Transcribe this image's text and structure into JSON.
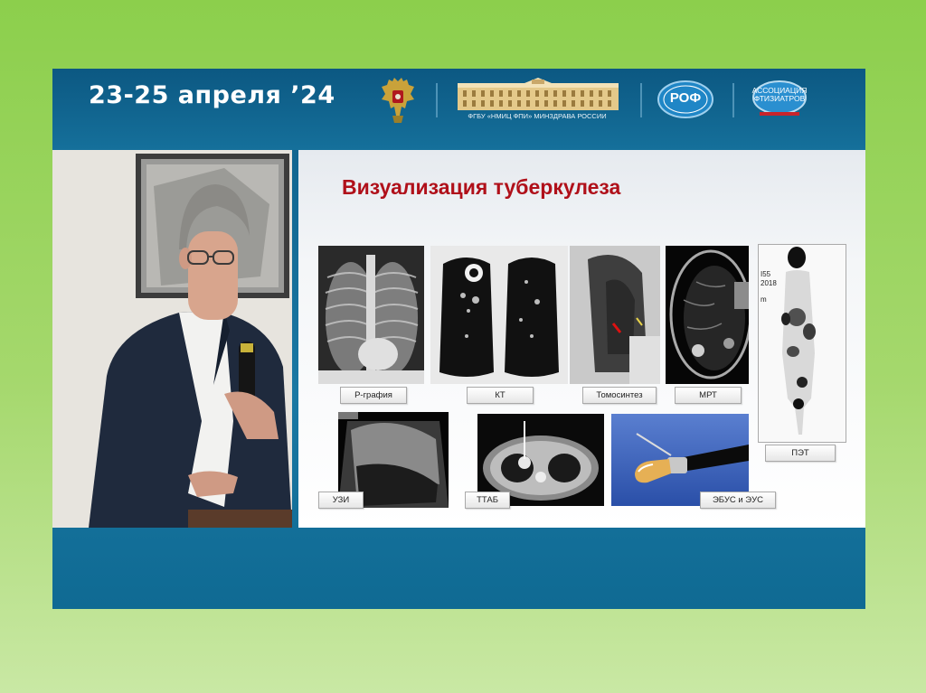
{
  "header": {
    "date": "23-25 апреля ’24",
    "institution_caption": "ФГБУ «НМИЦ ФПИ» МИНЗДРАВА РОССИИ",
    "rof_logo_text": "РОФ",
    "association_logo_text": "АССОЦИАЦИЯ ФТИЗИАТРОВ"
  },
  "slide": {
    "title": "Визуализация туберкулеза",
    "labels": {
      "xray": "Р-графия",
      "ct": "КТ",
      "tomosynthesis": "Томосинтез",
      "mri": "МРТ",
      "pet": "ПЭТ",
      "ultrasound": "УЗИ",
      "ttab": "ТТАБ",
      "ebus": "ЭБУС и ЭУС"
    },
    "pet_annotation": [
      "I55",
      "2018",
      "m"
    ]
  },
  "colors": {
    "outer_background": "#8ccf4c",
    "frame_blue": "#15709b",
    "title_red": "#b0101a"
  },
  "icons": {
    "emblem": "double-headed-eagle-icon",
    "institution": "building-icon",
    "rof": "rof-logo",
    "association": "association-logo"
  }
}
